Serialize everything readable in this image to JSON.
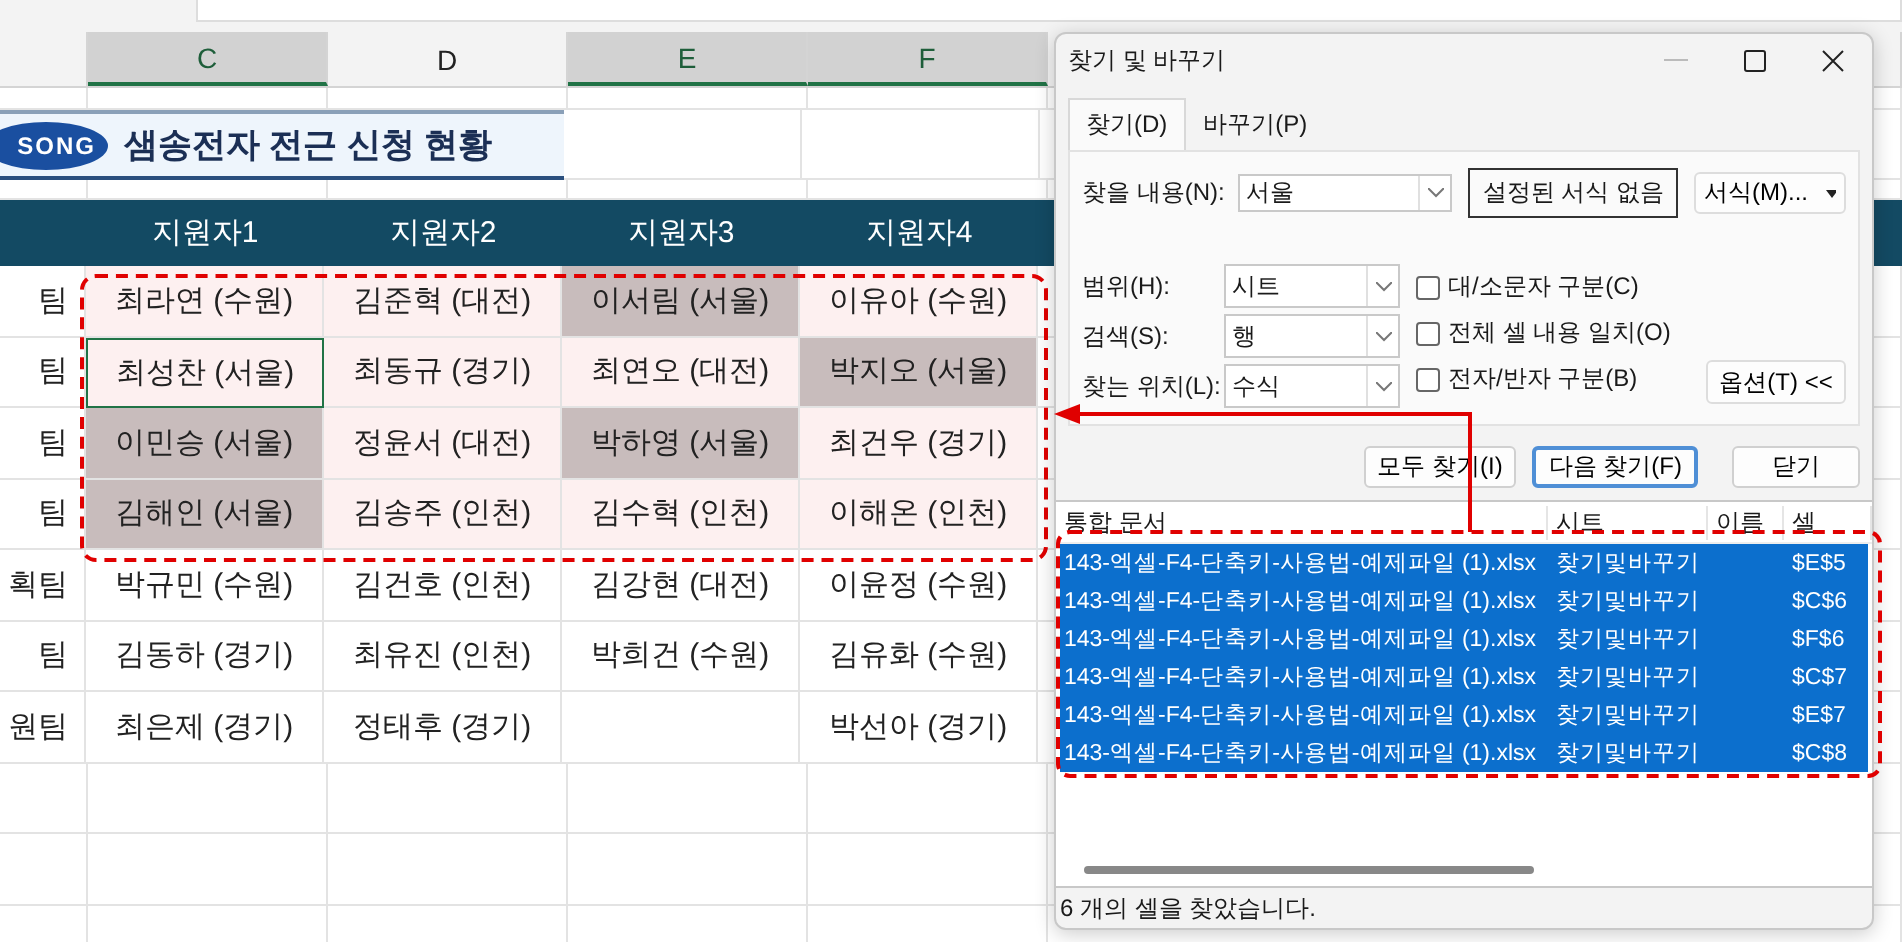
{
  "column_headers": [
    {
      "label": "C",
      "selected": true
    },
    {
      "label": "D",
      "selected": false
    },
    {
      "label": "E",
      "selected": true
    },
    {
      "label": "F",
      "selected": true
    }
  ],
  "banner": {
    "logo": "SONG",
    "title": "샘송전자 전근 신청 현황"
  },
  "table": {
    "columns": [
      "지원자1",
      "지원자2",
      "지원자3",
      "지원자4"
    ],
    "rows": [
      {
        "team": "팀",
        "cells": [
          {
            "text": "최라연 (수원)",
            "in_range": true,
            "found": false,
            "active": false
          },
          {
            "text": "김준혁 (대전)",
            "in_range": true,
            "found": false,
            "active": false
          },
          {
            "text": "이서림 (서울)",
            "in_range": true,
            "found": true,
            "active": false
          },
          {
            "text": "이유아 (수원)",
            "in_range": true,
            "found": false,
            "active": false
          }
        ]
      },
      {
        "team": "팀",
        "cells": [
          {
            "text": "최성찬 (서울)",
            "in_range": true,
            "found": false,
            "active": true
          },
          {
            "text": "최동규 (경기)",
            "in_range": true,
            "found": false,
            "active": false
          },
          {
            "text": "최연오 (대전)",
            "in_range": true,
            "found": false,
            "active": false
          },
          {
            "text": "박지오 (서울)",
            "in_range": true,
            "found": true,
            "active": false
          }
        ]
      },
      {
        "team": "팀",
        "cells": [
          {
            "text": "이민승 (서울)",
            "in_range": true,
            "found": true,
            "active": false
          },
          {
            "text": "정윤서 (대전)",
            "in_range": true,
            "found": false,
            "active": false
          },
          {
            "text": "박하영 (서울)",
            "in_range": true,
            "found": true,
            "active": false
          },
          {
            "text": "최건우 (경기)",
            "in_range": true,
            "found": false,
            "active": false
          }
        ]
      },
      {
        "team": "팀",
        "cells": [
          {
            "text": "김해인 (서울)",
            "in_range": true,
            "found": true,
            "active": false
          },
          {
            "text": "김송주 (인천)",
            "in_range": true,
            "found": false,
            "active": false
          },
          {
            "text": "김수혁 (인천)",
            "in_range": true,
            "found": false,
            "active": false
          },
          {
            "text": "이해온 (인천)",
            "in_range": true,
            "found": false,
            "active": false
          }
        ]
      },
      {
        "team": "획팀",
        "cells": [
          {
            "text": "박규민 (수원)",
            "in_range": false,
            "found": false,
            "active": false
          },
          {
            "text": "김건호 (인천)",
            "in_range": false,
            "found": false,
            "active": false
          },
          {
            "text": "김강현 (대전)",
            "in_range": false,
            "found": false,
            "active": false
          },
          {
            "text": "이윤정 (수원)",
            "in_range": false,
            "found": false,
            "active": false
          }
        ]
      },
      {
        "team": "팀",
        "cells": [
          {
            "text": "김동하 (경기)",
            "in_range": false,
            "found": false,
            "active": false
          },
          {
            "text": "최유진 (인천)",
            "in_range": false,
            "found": false,
            "active": false
          },
          {
            "text": "박희건 (수원)",
            "in_range": false,
            "found": false,
            "active": false
          },
          {
            "text": "김유화 (수원)",
            "in_range": false,
            "found": false,
            "active": false
          }
        ]
      },
      {
        "team": "원팀",
        "cells": [
          {
            "text": "최은제 (경기)",
            "in_range": false,
            "found": false,
            "active": false
          },
          {
            "text": "정태후 (경기)",
            "in_range": false,
            "found": false,
            "active": false
          },
          {
            "in_range": false,
            "found": false,
            "active": false
          },
          {
            "text": "박선아 (경기)",
            "in_range": false,
            "found": false,
            "active": false
          }
        ]
      }
    ]
  },
  "dialog": {
    "title": "찾기 및 바꾸기",
    "tabs": [
      {
        "label": "찾기(D)",
        "selected": true
      },
      {
        "label": "바꾸기(P)",
        "selected": false
      }
    ],
    "find_label": "찾을 내용(N):",
    "find_value": "서울",
    "format_preview": "설정된 서식 없음",
    "format_button": "서식(M)...",
    "options": [
      {
        "label": "범위(H):",
        "value": "시트"
      },
      {
        "label": "검색(S):",
        "value": "행"
      },
      {
        "label": "찾는 위치(L):",
        "value": "수식"
      }
    ],
    "checkboxes": [
      {
        "label": "대/소문자 구분(C)",
        "checked": false
      },
      {
        "label": "전체 셀 내용 일치(O)",
        "checked": false
      },
      {
        "label": "전자/반자 구분(B)",
        "checked": false
      }
    ],
    "options_button": "옵션(T) <<",
    "buttons": [
      {
        "label": "모두 찾기(I)",
        "focused": false
      },
      {
        "label": "다음 찾기(F)",
        "focused": true
      },
      {
        "label": "닫기",
        "focused": false
      }
    ],
    "results": {
      "columns": [
        "통합 문서",
        "시트",
        "이름",
        "셀"
      ],
      "rows": [
        {
          "workbook": "143-엑셀-F4-단축키-사용법-예제파일 (1).xlsx",
          "sheet": "찾기및바꾸기",
          "cell": "$E$5",
          "selected": true
        },
        {
          "workbook": "143-엑셀-F4-단축키-사용법-예제파일 (1).xlsx",
          "sheet": "찾기및바꾸기",
          "cell": "$C$6",
          "selected": true
        },
        {
          "workbook": "143-엑셀-F4-단축키-사용법-예제파일 (1).xlsx",
          "sheet": "찾기및바꾸기",
          "cell": "$F$6",
          "selected": true
        },
        {
          "workbook": "143-엑셀-F4-단축키-사용법-예제파일 (1).xlsx",
          "sheet": "찾기및바꾸기",
          "cell": "$C$7",
          "selected": true
        },
        {
          "workbook": "143-엑셀-F4-단축키-사용법-예제파일 (1).xlsx",
          "sheet": "찾기및바꾸기",
          "cell": "$E$7",
          "selected": true
        },
        {
          "workbook": "143-엑셀-F4-단축키-사용법-예제파일 (1).xlsx",
          "sheet": "찾기및바꾸기",
          "cell": "$C$8",
          "selected": true
        }
      ]
    },
    "status": "6 개의 셀을 찾았습니다."
  }
}
